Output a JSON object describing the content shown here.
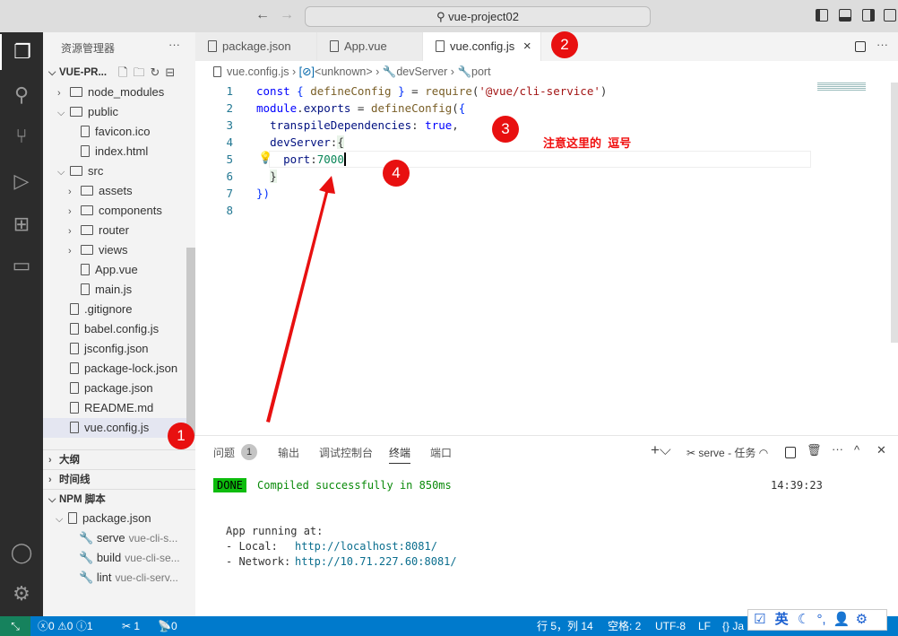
{
  "titlebar": {
    "search": "vue-project02",
    "back": "←",
    "forward": "→"
  },
  "activity": {
    "items": [
      "files-icon",
      "search-icon",
      "source-control-icon",
      "run-debug-icon",
      "extensions-icon",
      "remote-explorer-icon"
    ],
    "bottom": [
      "account-icon",
      "gear-icon"
    ]
  },
  "sidebar": {
    "title": "资源管理器",
    "more": "···",
    "project": "VUE-PR...",
    "tree": [
      {
        "label": "node_modules",
        "type": "folder",
        "depth": 1,
        "open": false
      },
      {
        "label": "public",
        "type": "folder",
        "depth": 1,
        "open": true
      },
      {
        "label": "favicon.ico",
        "type": "file",
        "depth": 2
      },
      {
        "label": "index.html",
        "type": "file",
        "depth": 2
      },
      {
        "label": "src",
        "type": "folder",
        "depth": 1,
        "open": true
      },
      {
        "label": "assets",
        "type": "folder",
        "depth": 2,
        "open": false
      },
      {
        "label": "components",
        "type": "folder",
        "depth": 2,
        "open": false
      },
      {
        "label": "router",
        "type": "folder",
        "depth": 2,
        "open": false
      },
      {
        "label": "views",
        "type": "folder",
        "depth": 2,
        "open": false
      },
      {
        "label": "App.vue",
        "type": "file",
        "depth": 2
      },
      {
        "label": "main.js",
        "type": "file",
        "depth": 2
      },
      {
        "label": ".gitignore",
        "type": "file",
        "depth": 1
      },
      {
        "label": "babel.config.js",
        "type": "file",
        "depth": 1
      },
      {
        "label": "jsconfig.json",
        "type": "file",
        "depth": 1
      },
      {
        "label": "package-lock.json",
        "type": "file",
        "depth": 1
      },
      {
        "label": "package.json",
        "type": "file",
        "depth": 1
      },
      {
        "label": "README.md",
        "type": "file",
        "depth": 1
      },
      {
        "label": "vue.config.js",
        "type": "file",
        "depth": 1,
        "selected": true
      }
    ],
    "outline": "大纲",
    "timeline": "时间线",
    "npm": "NPM 脚本",
    "npm_file": "package.json",
    "scripts": [
      {
        "name": "serve",
        "cmd": "vue-cli-s..."
      },
      {
        "name": "build",
        "cmd": "vue-cli-se..."
      },
      {
        "name": "lint",
        "cmd": "vue-cli-serv..."
      }
    ]
  },
  "tabs": [
    {
      "label": "package.json"
    },
    {
      "label": "App.vue"
    },
    {
      "label": "vue.config.js",
      "active": true,
      "close": "×"
    }
  ],
  "breadcrumb": [
    "vue.config.js",
    "<unknown>",
    "devServer",
    "port"
  ],
  "editor": {
    "line_numbers": [
      "1",
      "2",
      "3",
      "4",
      "5",
      "6",
      "7",
      "8"
    ]
  },
  "annotations": {
    "b1": "1",
    "b2": "2",
    "b3": "3",
    "b4": "4",
    "note": "注意这里的  逗号",
    "color": "#e81010"
  },
  "panel": {
    "tabs": [
      "问题",
      "输出",
      "调试控制台",
      "终端",
      "端口"
    ],
    "problems_count": "1",
    "active": "终端",
    "task": "serve - 任务",
    "done": "DONE",
    "compiled": "Compiled successfully in 850ms",
    "time": "14:39:23",
    "running": "App running at:",
    "local_label": "- Local:   ",
    "local_url": "http://localhost:8081/",
    "network_label": "- Network: ",
    "network_url": "http://10.71.227.60:8081/"
  },
  "status": {
    "errors": "0",
    "warnings": "0",
    "info": "1",
    "tasks": "1",
    "ports": "0",
    "position": "行 5，列 14",
    "spaces": "空格: 2",
    "encoding": "UTF-8",
    "eol": "LF",
    "lang": "Ja"
  },
  "ime": {
    "lang": "英"
  }
}
